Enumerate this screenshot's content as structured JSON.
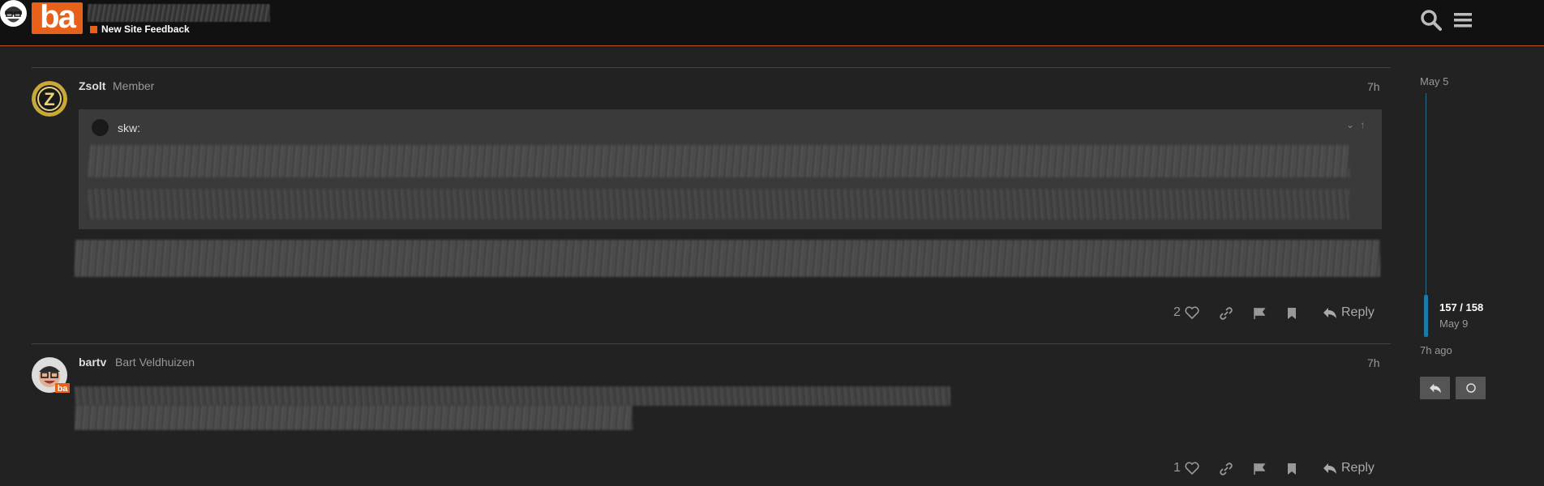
{
  "header": {
    "category": "New Site Feedback",
    "logo_text": "ba"
  },
  "posts": [
    {
      "username": "Zsolt",
      "user_title": "Member",
      "time": "7h",
      "quote_user": "skw:",
      "likes": "2",
      "reply_label": "Reply"
    },
    {
      "username": "bartv",
      "user_title": "Bart Veldhuizen",
      "time": "7h",
      "likes": "1",
      "reply_label": "Reply"
    }
  ],
  "timeline": {
    "start_date": "May 5",
    "position": "157 / 158",
    "current_date": "May 9",
    "last_activity": "7h ago",
    "position_fraction": 0.994
  },
  "colors": {
    "accent": "#e8611a",
    "timeline": "#1a7aa8",
    "background": "#222222"
  },
  "icons": [
    "search-icon",
    "hamburger-menu-icon",
    "heart-icon",
    "link-icon",
    "flag-icon",
    "bookmark-icon",
    "reply-icon",
    "chevron-down-icon",
    "arrow-up-icon",
    "circle-icon"
  ]
}
